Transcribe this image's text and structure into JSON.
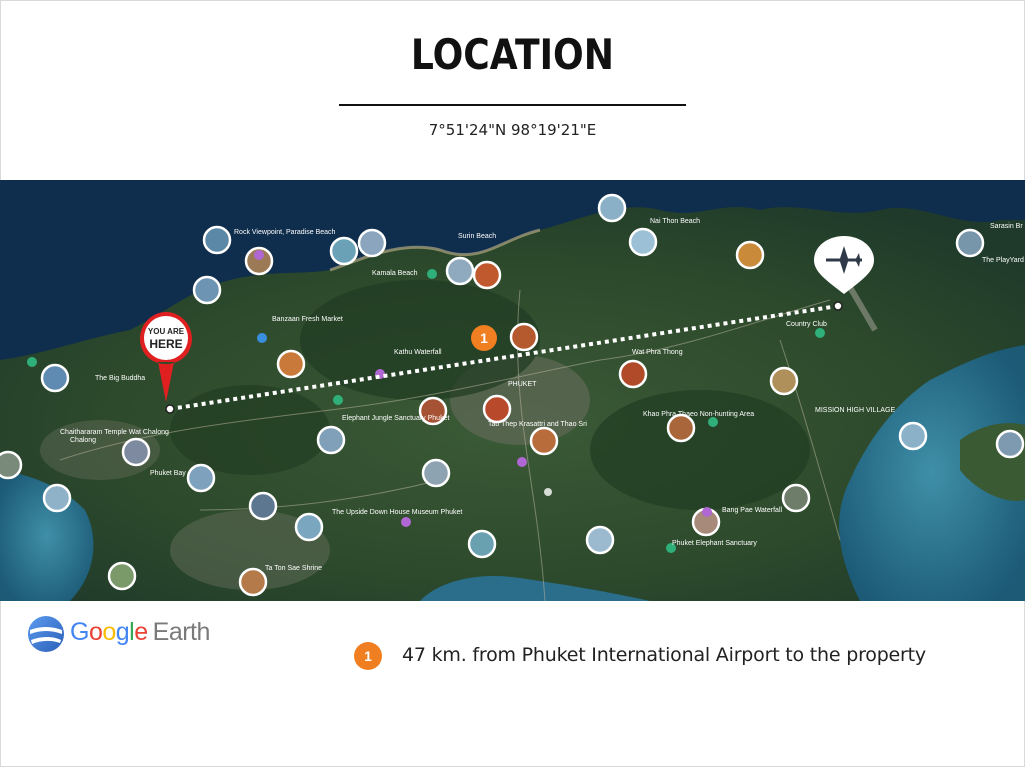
{
  "header": {
    "title": "LOCATION",
    "coordinates": "7°51'24\"N 98°19'21\"E"
  },
  "map": {
    "you_are_here_line1": "YOU ARE",
    "you_are_here_line2": "HERE",
    "route_marker": "1",
    "labels": [
      "Rock Viewpoint, Paradise Beach",
      "Surin Beach",
      "Nai Thon Beach",
      "Sarasin Br",
      "The PlayYard",
      "Kamala Beach",
      "Banzaan Fresh Market",
      "Kathu Waterfall",
      "The Big Buddha",
      "Chalong",
      "Wat Phra Thong",
      "PHUKET",
      "Elephant Jungle Sanctuary Phuket",
      "Khao Phra Thaeo Non-hunting Area",
      "Tao Thep Krasattri and Thao Sri",
      "Bang Pae Waterfall",
      "Phuket Elephant Sanctuary",
      "The Upside Down House Museum Phuket",
      "Chaithararam Temple Wat Chalong",
      "Ta Ton Sae Shrine",
      "Phuket Bay",
      "Country Club",
      "MISSION HIGH VILLAGE"
    ]
  },
  "footer": {
    "brand_google": [
      "G",
      "o",
      "o",
      "g",
      "l",
      "e"
    ],
    "brand_earth": "Earth",
    "legend_number": "1",
    "legend_text": "47 km. from Phuket International Airport to the property"
  },
  "colors": {
    "accent_orange": "#f07f22",
    "pin_red": "#e02020",
    "sea": "#0e2f4e",
    "land": "#2c4a30"
  }
}
